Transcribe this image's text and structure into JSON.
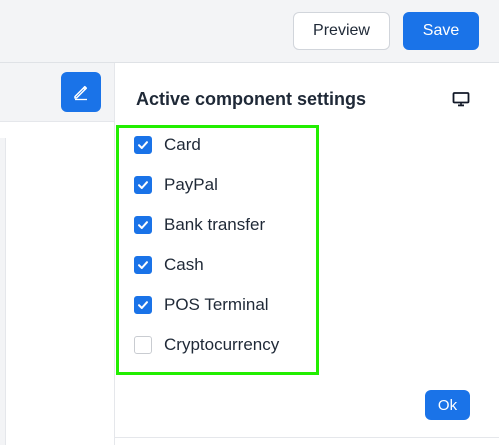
{
  "toolbar": {
    "preview_label": "Preview",
    "save_label": "Save"
  },
  "left_panel": {
    "edit_icon": "pencil-icon"
  },
  "settings": {
    "title": "Active component settings",
    "device_icon": "monitor-icon",
    "options": [
      {
        "label": "Card",
        "checked": true
      },
      {
        "label": "PayPal",
        "checked": true
      },
      {
        "label": "Bank transfer",
        "checked": true
      },
      {
        "label": "Cash",
        "checked": true
      },
      {
        "label": "POS Terminal",
        "checked": true
      },
      {
        "label": "Cryptocurrency",
        "checked": false
      }
    ],
    "ok_label": "Ok"
  },
  "colors": {
    "accent": "#1a73e8",
    "highlight": "#22ee00"
  }
}
